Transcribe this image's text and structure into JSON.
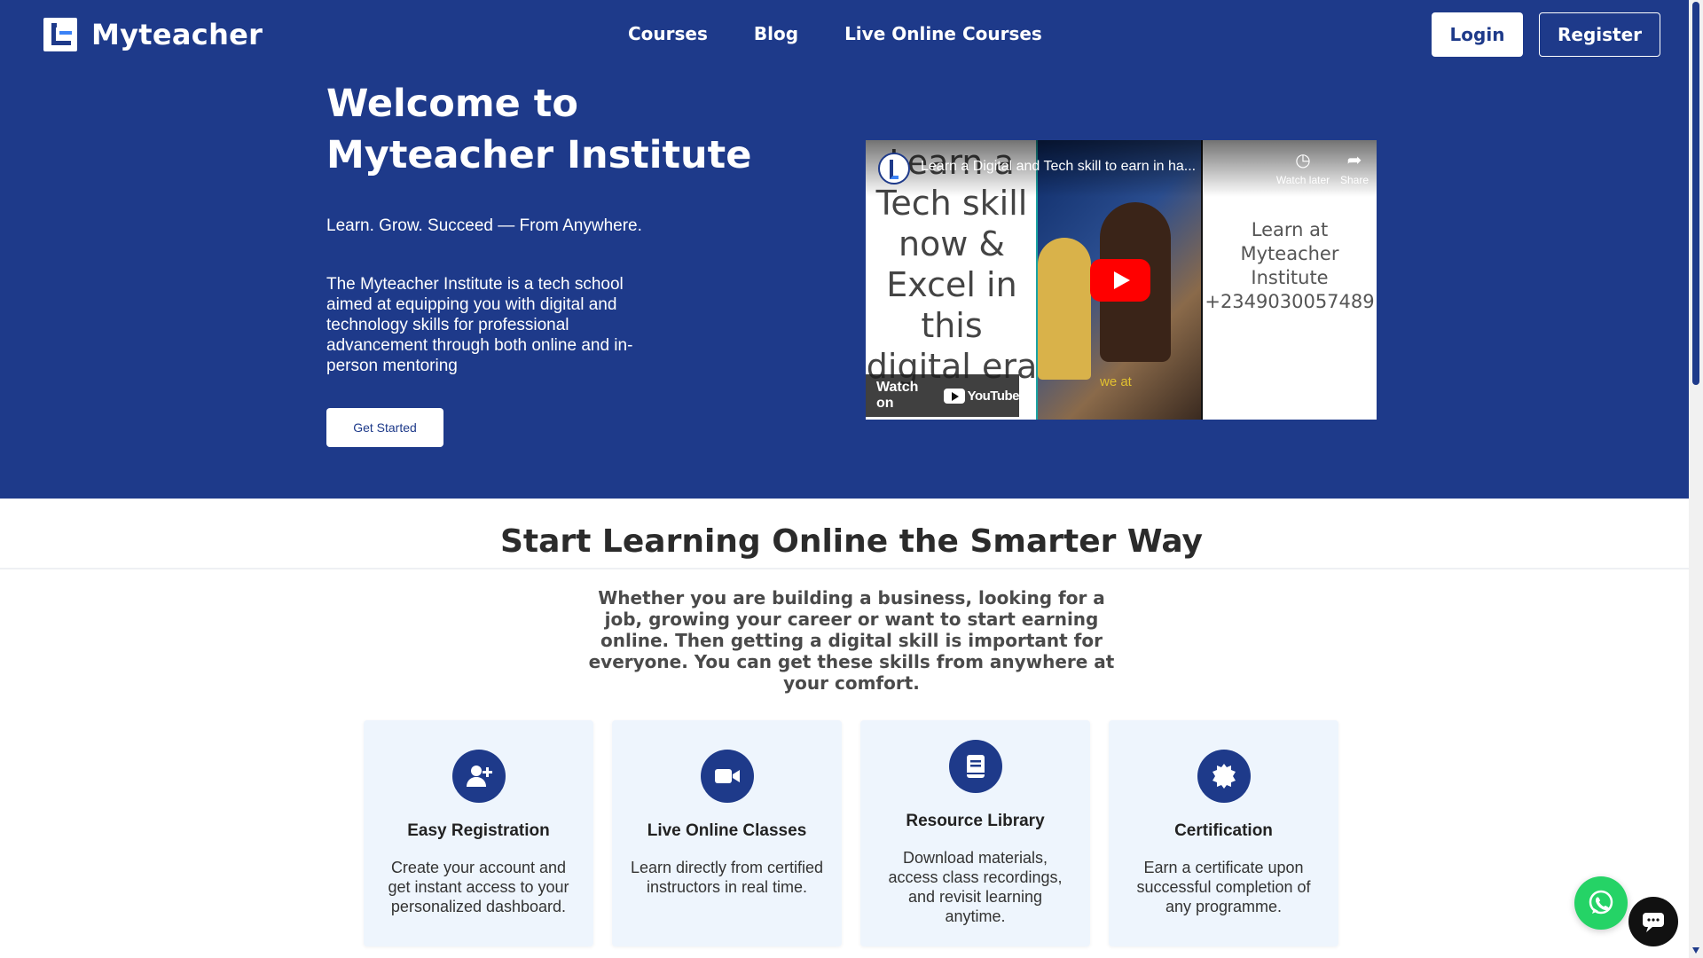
{
  "brand": {
    "name": "Myteacher"
  },
  "nav": {
    "links": [
      "Courses",
      "Blog",
      "Live Online Courses"
    ],
    "login": "Login",
    "register": "Register"
  },
  "hero": {
    "title": "Welcome to Myteacher Institute",
    "tagline": "Learn. Grow. Succeed — From Anywhere.",
    "description": "The Myteacher Institute is a tech school aimed at equipping you with digital and technology skills for professional advancement through both online and in-person mentoring",
    "cta": "Get Started"
  },
  "video": {
    "title": "Learn a Digital and Tech skill to earn in ha...",
    "left_text": "Learn a Tech skill now & Excel in this digital era",
    "right_text": "Learn at Myteacher Institute +2349030057489",
    "caption": "we at",
    "watch_later": "Watch later",
    "share": "Share",
    "watch_on": "Watch on",
    "youtube": "YouTube"
  },
  "section": {
    "title": "Start Learning Online the Smarter Way",
    "description": "Whether you are building a business, looking for a job, growing your career or want to start earning online. Then getting a digital skill is important for everyone. You can get these skills from anywhere at your comfort."
  },
  "features": [
    {
      "title": "Easy Registration",
      "text": "Create your account and get instant access to your personalized dashboard.",
      "icon": "user-plus-icon"
    },
    {
      "title": "Live Online Classes",
      "text": "Learn directly from certified instructors in real time.",
      "icon": "video-camera-icon"
    },
    {
      "title": "Resource Library",
      "text": "Download materials, access class recordings, and revisit learning anytime.",
      "icon": "book-icon"
    },
    {
      "title": "Certification",
      "text": "Earn a certificate upon successful completion of any programme.",
      "icon": "certificate-badge-icon"
    }
  ],
  "colors": {
    "primary": "#1e3a8a",
    "whatsapp": "#25d366",
    "card_bg": "#eef5fd"
  }
}
